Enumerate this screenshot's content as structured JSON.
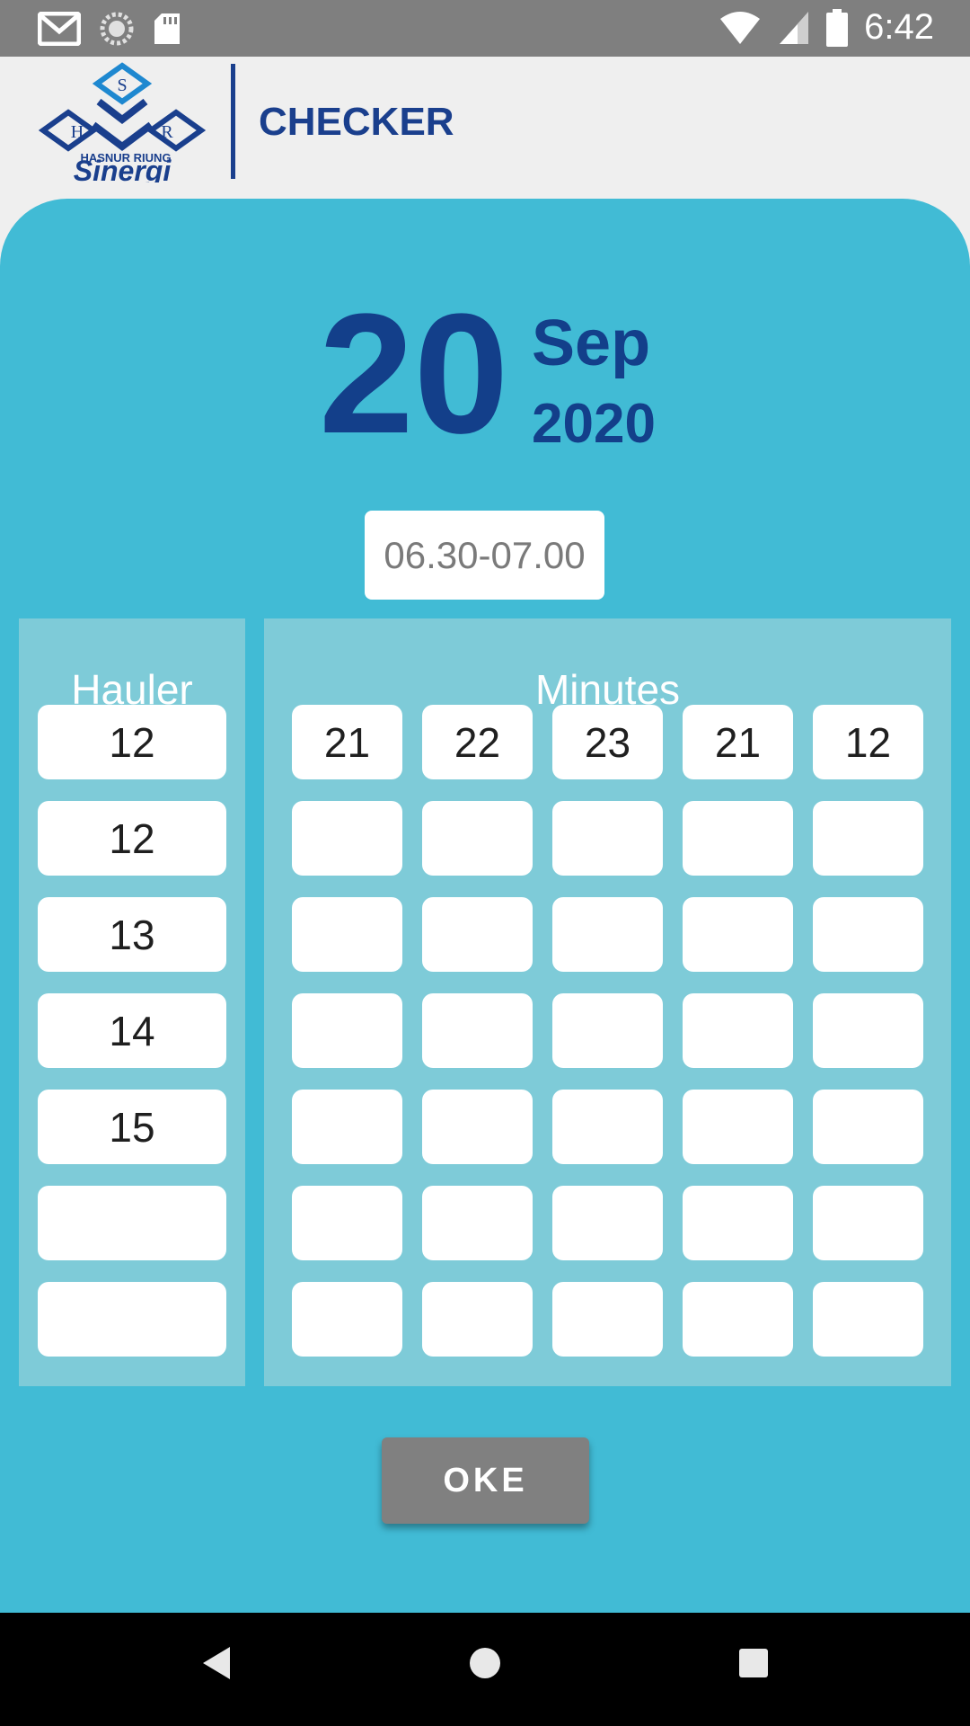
{
  "status_bar": {
    "time": "6:42",
    "left_icons": [
      "gmail-icon",
      "sync-icon",
      "sd-card-icon"
    ],
    "right_icons": [
      "wifi-icon",
      "signal-icon",
      "battery-icon"
    ]
  },
  "header": {
    "logo_letters": [
      "S",
      "H",
      "R"
    ],
    "logo_text_small": "HASNUR RIUNG",
    "logo_text_big": "Sinergi",
    "title": "CHECKER"
  },
  "date": {
    "day": "20",
    "month": "Sep",
    "year": "2020"
  },
  "time_slot": "06.30-07.00",
  "hauler": {
    "title": "Hauler",
    "values": [
      "12",
      "12",
      "13",
      "14",
      "15",
      "",
      ""
    ]
  },
  "minutes": {
    "title": "Minutes",
    "rows": [
      [
        "21",
        "22",
        "23",
        "21",
        "12"
      ],
      [
        "",
        "",
        "",
        "",
        ""
      ],
      [
        "",
        "",
        "",
        "",
        ""
      ],
      [
        "",
        "",
        "",
        "",
        ""
      ],
      [
        "",
        "",
        "",
        "",
        ""
      ],
      [
        "",
        "",
        "",
        "",
        ""
      ],
      [
        "",
        "",
        "",
        "",
        ""
      ]
    ]
  },
  "ok_button": "OKE",
  "nav": [
    "back-icon",
    "home-icon",
    "recents-icon"
  ],
  "colors": {
    "panel": "#41bbd5",
    "subpanel": "#7ecbd8",
    "brand": "#1a3f8d",
    "status_bar": "#7f7f7f"
  }
}
